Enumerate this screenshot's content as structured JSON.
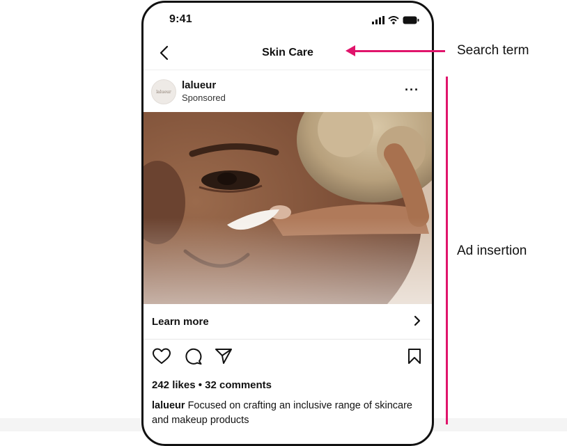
{
  "status_bar": {
    "time": "9:41"
  },
  "nav": {
    "title": "Skin Care"
  },
  "post": {
    "username": "lalueur",
    "avatar_text": "lalueur",
    "sponsored": "Sponsored",
    "more": "···",
    "cta_label": "Learn more",
    "likes_line": "242 likes • 32 comments",
    "caption_user": "lalueur",
    "caption_text": " Focused on crafting an inclusive range of skincare and makeup products"
  },
  "annotations": {
    "search_term": "Search term",
    "ad_insertion": "Ad insertion"
  },
  "colors": {
    "accent": "#e0146b",
    "frame": "#111111"
  },
  "icons": {
    "back": "chevron-left-icon",
    "like": "heart-icon",
    "comment": "comment-icon",
    "share": "send-icon",
    "save": "bookmark-icon",
    "more": "more-dots-icon",
    "cta": "chevron-right-icon"
  }
}
